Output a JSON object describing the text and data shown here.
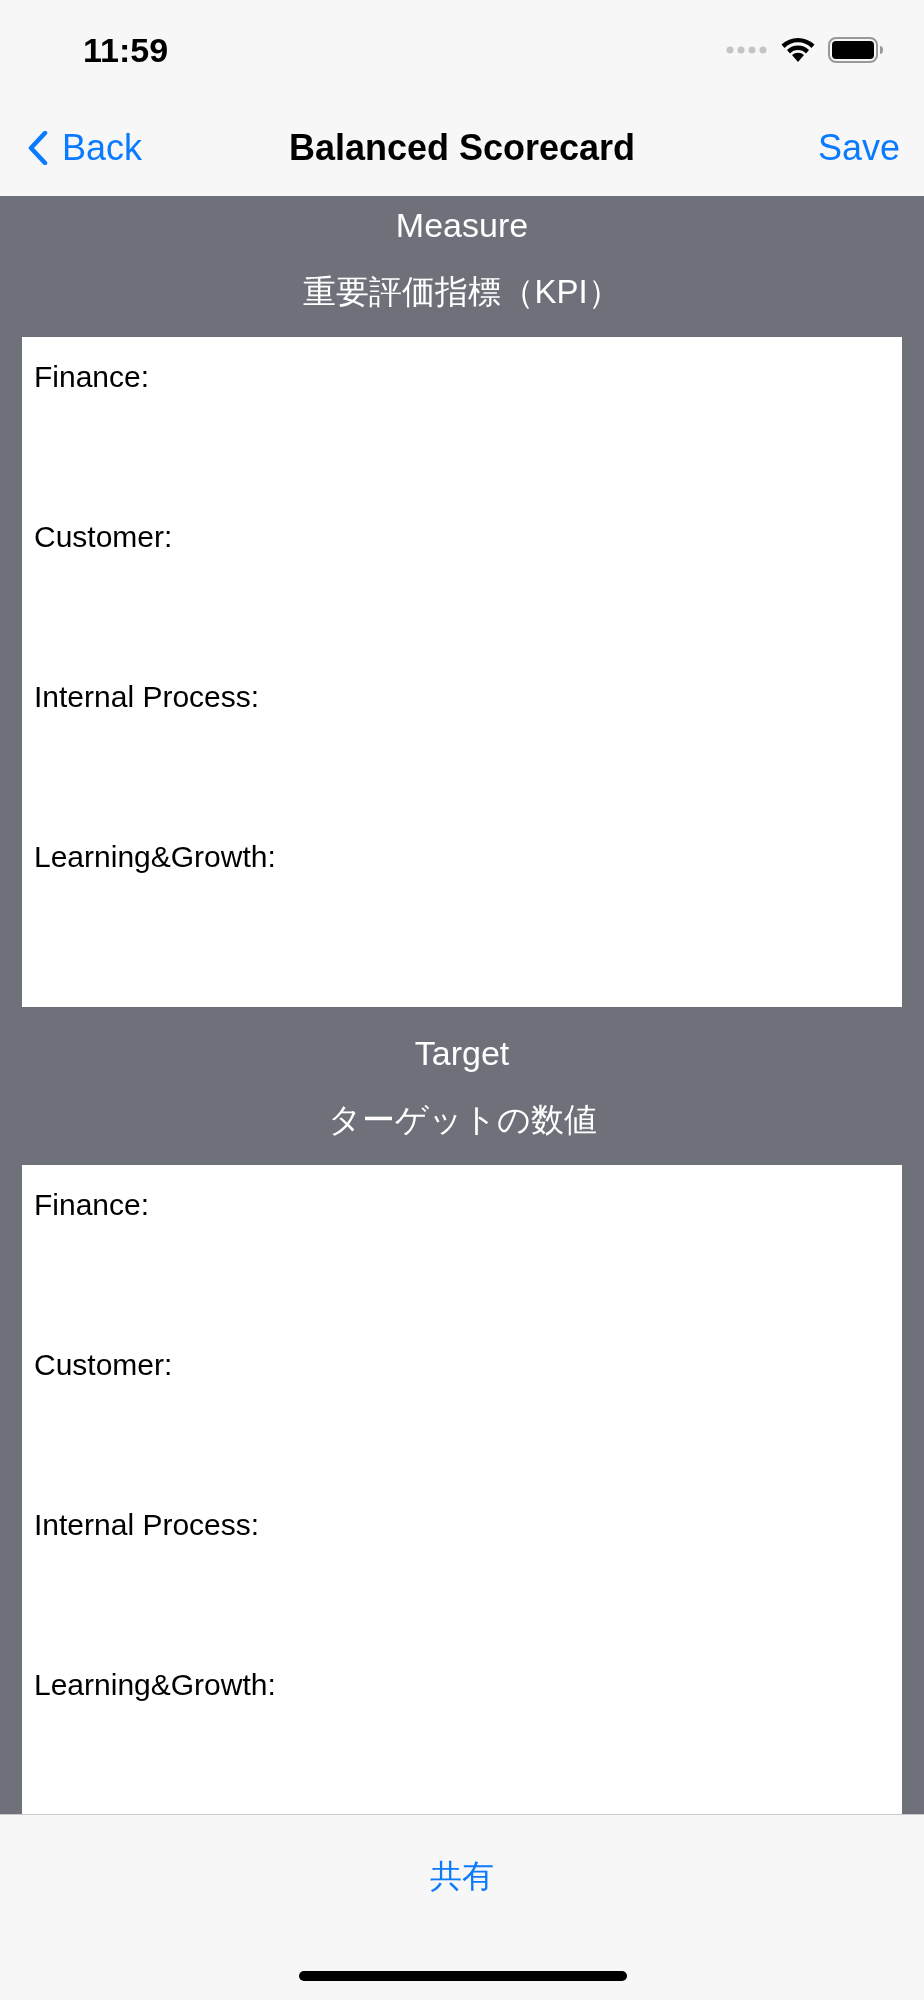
{
  "status_bar": {
    "time": "11:59"
  },
  "nav_bar": {
    "back": "Back",
    "title": "Balanced Scorecard",
    "action": "Save"
  },
  "sections": [
    {
      "title": "Measure",
      "subtitle": "重要評価指標（KPI）",
      "lines": [
        "Finance:",
        "Customer:",
        "Internal Process:",
        "Learning&Growth:"
      ]
    },
    {
      "title": "Target",
      "subtitle": "ターゲットの数値",
      "lines": [
        "Finance:",
        "Customer:",
        "Internal Process:",
        "Learning&Growth:"
      ]
    }
  ],
  "toolbar": {
    "button": "共有"
  }
}
